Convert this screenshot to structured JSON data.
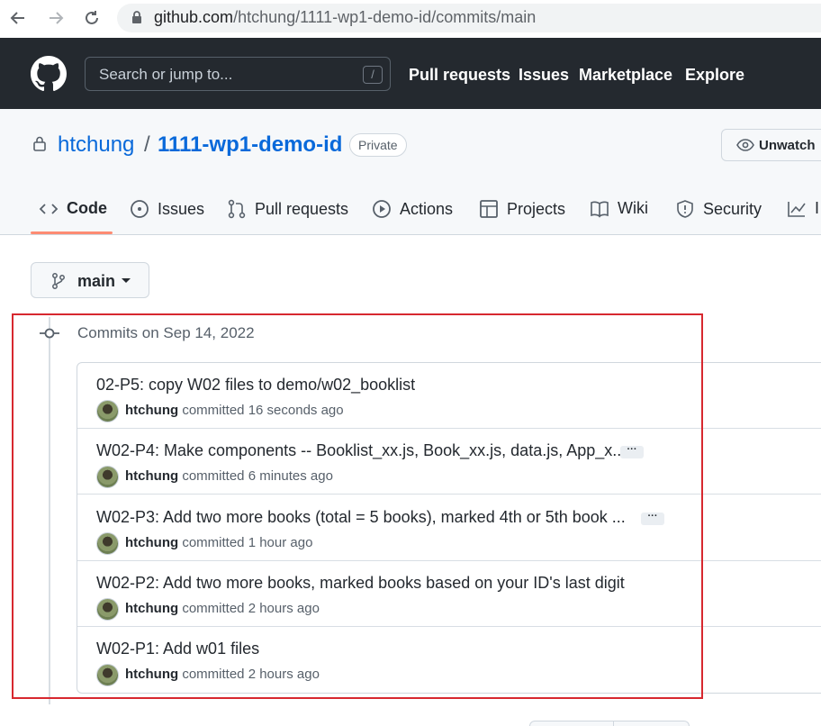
{
  "browser": {
    "url_host": "github.com",
    "url_path": "/htchung/1111-wp1-demo-id/commits/main"
  },
  "header": {
    "search_placeholder": "Search or jump to...",
    "search_shortcut": "/",
    "nav": [
      "Pull requests",
      "Issues",
      "Marketplace",
      "Explore"
    ]
  },
  "repo": {
    "owner": "htchung",
    "separator": "/",
    "name": "1111-wp1-demo-id",
    "visibility": "Private",
    "watch_label": "Unwatch"
  },
  "tabs": [
    {
      "label": "Code",
      "icon": "code-icon",
      "active": true
    },
    {
      "label": "Issues",
      "icon": "issue-opened-icon"
    },
    {
      "label": "Pull requests",
      "icon": "git-pull-request-icon"
    },
    {
      "label": "Actions",
      "icon": "play-icon"
    },
    {
      "label": "Projects",
      "icon": "table-icon"
    },
    {
      "label": "Wiki",
      "icon": "book-icon"
    },
    {
      "label": "Security",
      "icon": "shield-icon"
    },
    {
      "label": "I",
      "icon": "graph-icon"
    }
  ],
  "branch": {
    "name": "main"
  },
  "commits": {
    "date_heading": "Commits on Sep 14, 2022",
    "items": [
      {
        "message": "02-P5: copy W02 files to demo/w02_booklist",
        "author": "htchung",
        "action": "committed",
        "time": "16 seconds ago",
        "has_more": false
      },
      {
        "message": "W02-P4: Make components -- Booklist_xx.js, Book_xx.js, data.js, App_x...",
        "author": "htchung",
        "action": "committed",
        "time": "6 minutes ago",
        "has_more": true
      },
      {
        "message": "W02-P3: Add two more books (total = 5 books), marked 4th or 5th book ...",
        "author": "htchung",
        "action": "committed",
        "time": "1 hour ago",
        "has_more": true
      },
      {
        "message": "W02-P2: Add two more books, marked books based on your ID's last digit",
        "author": "htchung",
        "action": "committed",
        "time": "2 hours ago",
        "has_more": false
      },
      {
        "message": "W02-P1: Add w01 files",
        "author": "htchung",
        "action": "committed",
        "time": "2 hours ago",
        "has_more": false
      }
    ],
    "more_label": "···"
  },
  "colors": {
    "header_bg": "#24292f",
    "link_blue": "#0969da",
    "active_tab_underline": "#fd8c73",
    "highlight_red": "#d7282f"
  }
}
